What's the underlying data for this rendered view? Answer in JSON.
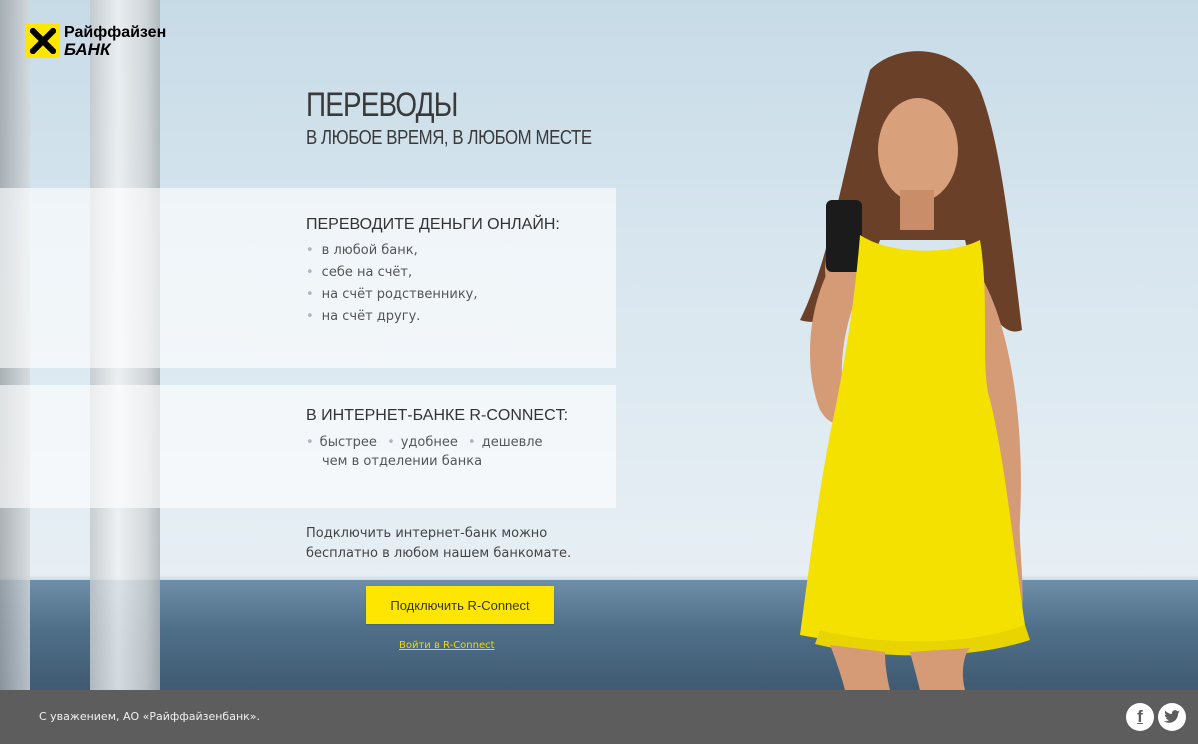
{
  "brand": {
    "line1": "Райффайзен",
    "line2": "БАНК",
    "accent": "#fee600"
  },
  "hero": {
    "title": "ПЕРЕВОДЫ",
    "subtitle": "В ЛЮБОЕ ВРЕМЯ, В ЛЮБОМ МЕСТЕ"
  },
  "online_block": {
    "heading": "ПЕРЕВОДИТЕ ДЕНЬГИ ОНЛАЙН:",
    "items": [
      "в любой банк,",
      "себе на счёт,",
      "на счёт родственнику,",
      "на счёт другу."
    ]
  },
  "rconnect_block": {
    "heading": "В ИНТЕРНЕТ-БАНКЕ R-CONNECT:",
    "items": [
      "быстрее",
      "удобнее",
      "дешевле"
    ],
    "line2": "чем в отделении банка"
  },
  "note": "Подключить интернет-банк можно бесплатно в любом нашем банкомате.",
  "cta": {
    "button_label": "Подключить R-Connect",
    "link_label": "Войти в R-Connect"
  },
  "footer": {
    "text": "С уважением, АО «Райффайзенбанк».",
    "footer_color": "#5d5d5d"
  },
  "social": [
    {
      "icon": "facebook-icon",
      "glyph": "f"
    },
    {
      "icon": "twitter-icon",
      "glyph": "t"
    }
  ]
}
